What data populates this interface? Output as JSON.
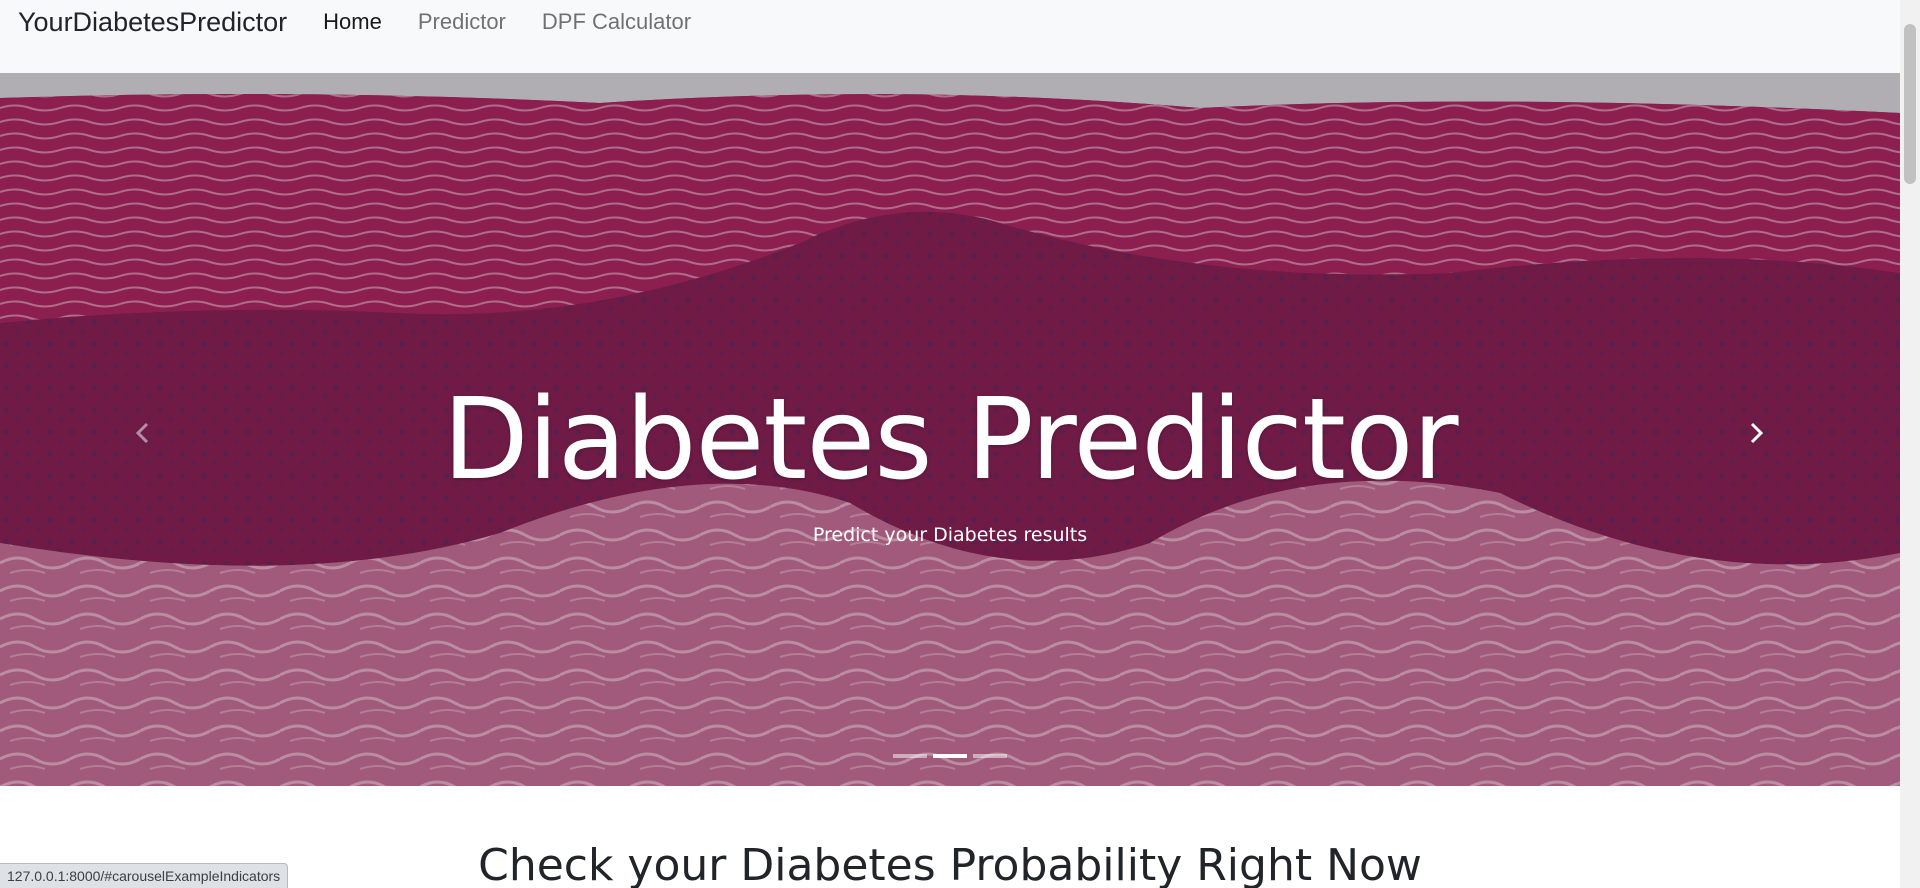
{
  "navbar": {
    "brand": "YourDiabetesPredictor",
    "links": [
      {
        "label": "Home",
        "active": true
      },
      {
        "label": "Predictor",
        "active": false
      },
      {
        "label": "DPF Calculator",
        "active": false
      }
    ]
  },
  "carousel": {
    "title": "Diabetes Predictor",
    "subtitle": "Predict your Diabetes results",
    "indicators_count": 3,
    "active_indicator": 2,
    "prev_icon": "chevron-left-icon",
    "next_icon": "chevron-right-icon"
  },
  "main": {
    "heading": "Check your Diabetes Probability Right Now"
  },
  "status_bar": {
    "url": "127.0.0.1:8000/#carouselExampleIndicators"
  },
  "colors": {
    "navbar_bg": "#f8f9fa",
    "tissue_primary": "#a9476e",
    "tissue_dark": "#7a1a45"
  }
}
